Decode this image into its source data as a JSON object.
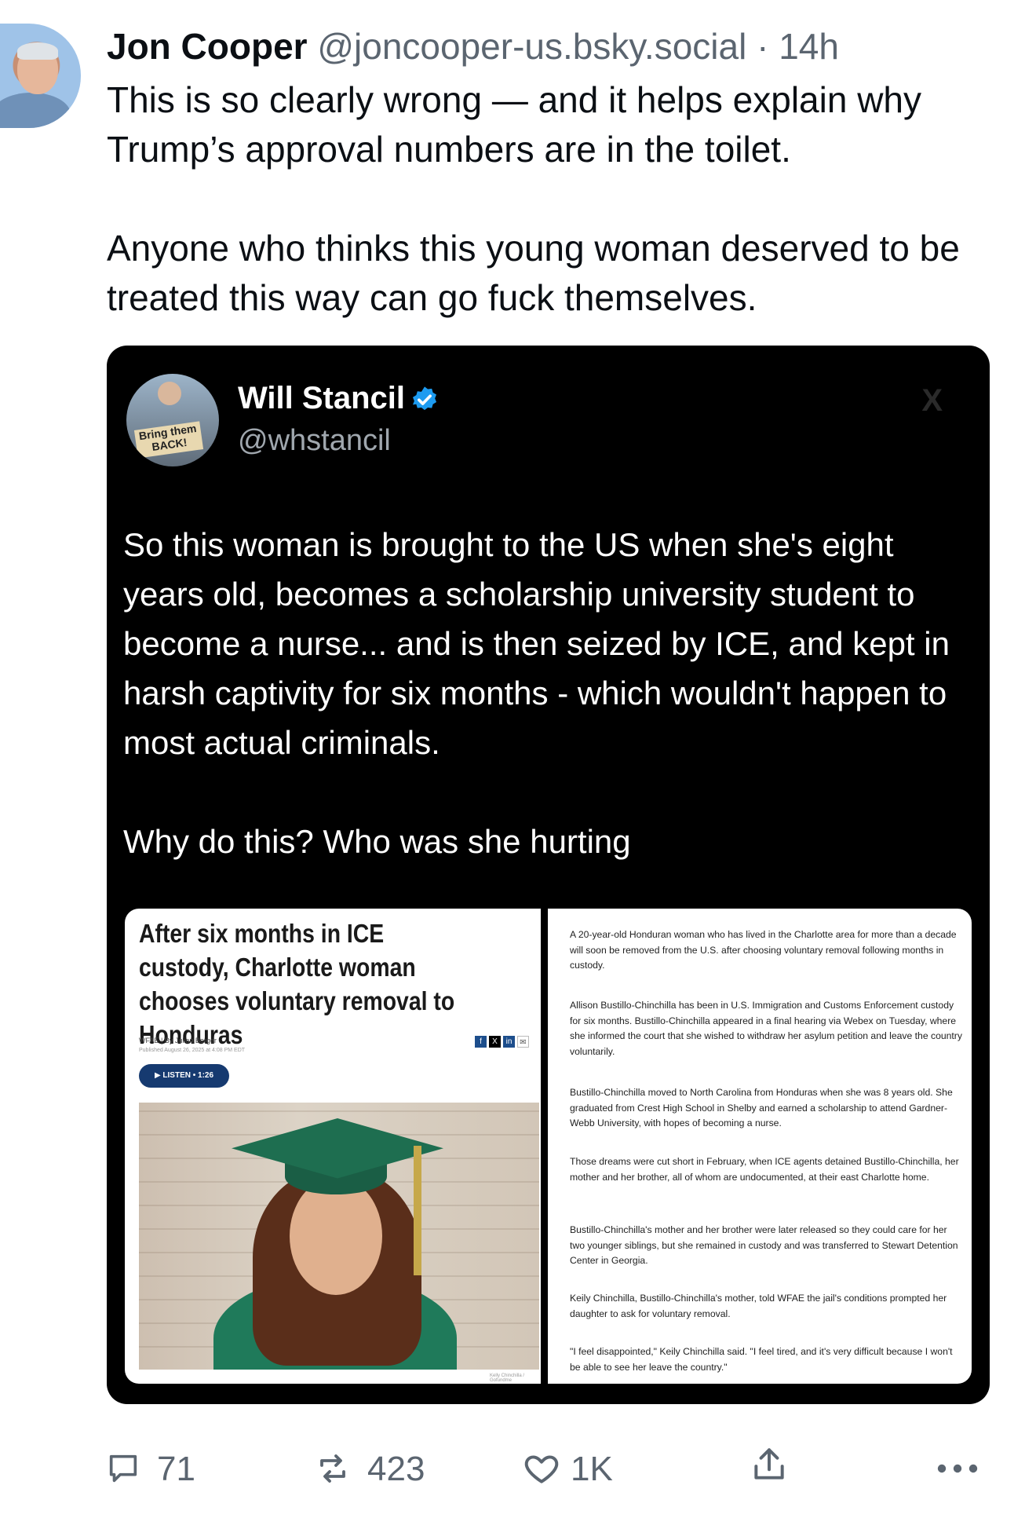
{
  "post": {
    "author_name": "Jon Cooper",
    "author_handle": "@joncooper-us.bsky.social",
    "separator": "·",
    "time": "14h",
    "paragraphs": [
      "This is so clearly wrong — and it helps explain why Trump’s approval numbers are in the toilet.",
      "Anyone who thinks this young woman deserved to be treated this way can go fuck themselves."
    ]
  },
  "quoted": {
    "name": "Will Stancil",
    "handle": "@whstancil",
    "avatar_sign": "Bring them BACK!",
    "paragraphs": [
      "So this woman is brought to the US when she's eight years old, becomes a scholarship university student to become a nurse... and is then seized by ICE, and kept in harsh captivity for six months - which wouldn't happen to most actual criminals.",
      "Why do this? Who was she hurting"
    ],
    "article": {
      "headline": "After six months in ICE custody, Charlotte woman chooses voluntary removal to Honduras",
      "byline": "WFAE | By Julian Berger",
      "published": "Published August 26, 2025 at 4:08 PM EDT",
      "listen_label": "▶ LISTEN • 1:26",
      "photo_credit": "Kelly Chinchilla / Gofundme",
      "body": [
        "A 20-year-old Honduran woman who has lived in the Charlotte area for more than a decade will soon be removed from the U.S. after choosing voluntary removal following months in custody.",
        "Allison Bustillo-Chinchilla has been in U.S. Immigration and Customs Enforcement custody for six months. Bustillo-Chinchilla appeared in a final hearing via Webex on Tuesday, where she informed the court that she wished to withdraw her asylum petition and leave the country voluntarily.",
        "Bustillo-Chinchilla moved to North Carolina from Honduras when she was 8 years old. She graduated from Crest High School in Shelby and earned a scholarship to attend Gardner-Webb University, with hopes of becoming a nurse.",
        "Those dreams were cut short in February, when ICE agents detained Bustillo-Chinchilla, her mother and her brother, all of whom are undocumented, at their east Charlotte home.",
        "Bustillo-Chinchilla's mother and her brother were later released so they could care for her two younger siblings, but she remained in custody and was transferred to Stewart Detention Center in Georgia.",
        "Keily Chinchilla, Bustillo-Chinchilla's mother, told WFAE the jail's conditions prompted her daughter to ask for voluntary removal.",
        "\"I feel disappointed,\" Keily Chinchilla said. \"I feel tired, and it's very difficult because I won't be able to see her leave the country.\""
      ]
    }
  },
  "actions": {
    "reply_count": "71",
    "repost_count": "423",
    "like_count": "1K"
  },
  "colors": {
    "accent_verified": "#1d9bf0",
    "icon_gray": "#5b6570"
  }
}
